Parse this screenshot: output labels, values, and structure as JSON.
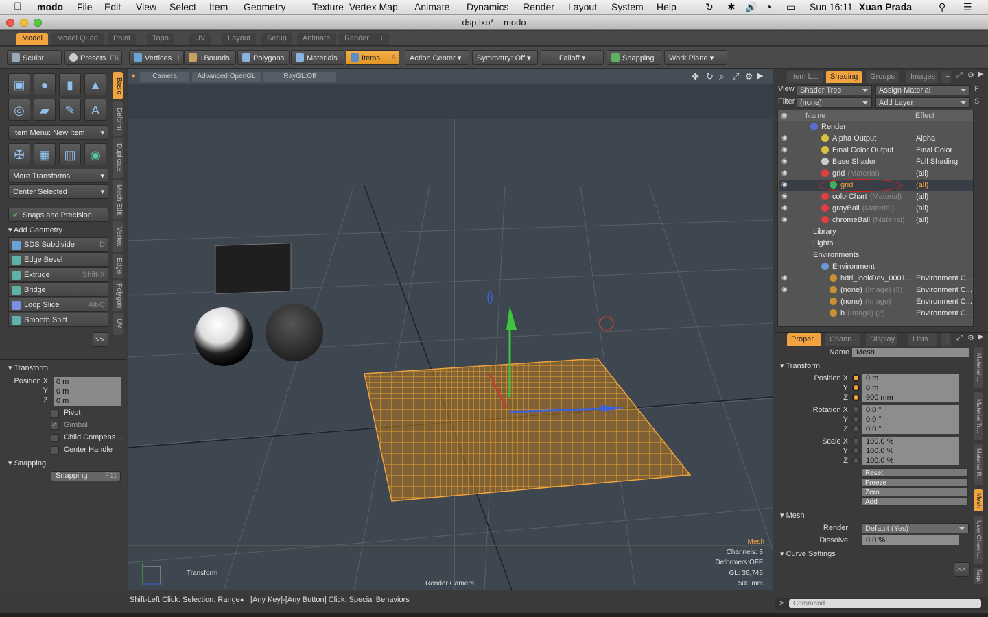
{
  "menubar": {
    "app": "modo",
    "items": [
      "File",
      "Edit",
      "View",
      "Select",
      "Item",
      "Geometry",
      "Texture",
      "Vertex Map",
      "Animate",
      "Dynamics",
      "Render",
      "Layout",
      "System",
      "Help"
    ],
    "clock": "Sun 16:11",
    "user": "Xuan Prada"
  },
  "window": {
    "title": "dsp.lxo* – modo"
  },
  "layout_tabs": [
    "Model",
    "Model Quad",
    "Paint",
    "Topo",
    "UV",
    "Layout",
    "Setup",
    "Animate",
    "Render",
    "+"
  ],
  "toolbar": {
    "sculpt": "Sculpt",
    "presets": "Presets",
    "presets_key": "F6",
    "vertices": "Vertices",
    "vertices_count": "1",
    "bounds": "+Bounds",
    "polygons": "Polygons",
    "materials": "Materials",
    "items": "Items",
    "items_count": "5",
    "action_center": "Action Center",
    "symmetry": "Symmetry: Off",
    "falloff": "Falloff",
    "snapping": "Snapping",
    "work_plane": "Work Plane"
  },
  "left": {
    "item_menu": "Item Menu: New Item",
    "more_transforms": "More Transforms",
    "center_selected": "Center Selected",
    "snaps_precision": "Snaps and Precision",
    "add_geometry": "Add Geometry",
    "tools": [
      {
        "label": "SDS Subdivide",
        "key": "D",
        "color": "#6aa3d8"
      },
      {
        "label": "Edge Bevel",
        "key": "",
        "color": "#5fb0a8"
      },
      {
        "label": "Extrude",
        "key": "Shift-X",
        "color": "#5fb0a8"
      },
      {
        "label": "Bridge",
        "key": "",
        "color": "#5fb0a8"
      },
      {
        "label": "Loop Slice",
        "key": "Alt-C",
        "color": "#7d8fe0"
      },
      {
        "label": "Smooth Shift",
        "key": "",
        "color": "#5fb0a8"
      }
    ],
    "more": ">>",
    "vtabs": [
      "Basic",
      "Deform",
      "Duplicate",
      "Mesh Edit",
      "Vertex",
      "Edge",
      "Polygon",
      "UV"
    ],
    "transform_hdr": "Transform",
    "position": [
      {
        "label": "Position X",
        "value": "0 m"
      },
      {
        "label": "Y",
        "value": "0 m"
      },
      {
        "label": "Z",
        "value": "0 m"
      }
    ],
    "checks": [
      {
        "label": "Pivot",
        "checked": false
      },
      {
        "label": "Gimbal",
        "checked": true
      },
      {
        "label": "Child Compens ...",
        "checked": false
      },
      {
        "label": "Center Handle",
        "checked": false
      }
    ],
    "snapping_hdr": "Snapping",
    "snapping_btn": "Snapping",
    "snapping_key": "F11"
  },
  "viewport": {
    "camera": "Camera",
    "shading": "Advanced OpenGL",
    "raygl": "RayGL:Off",
    "info_mesh": "Mesh",
    "info_channels": "Channels: 3",
    "info_deformers": "Deformers:OFF",
    "info_gl": "GL: 36,746",
    "info_scale": "500 mm",
    "tool_label": "Transform",
    "camera_label": "Render Camera"
  },
  "status": {
    "left": "Shift-Left Click: Selection: Range",
    "right": "[Any Key]-[Any Button] Click: Special Behaviors"
  },
  "shader": {
    "tabs": [
      "Item L...",
      "Shading",
      "Groups",
      "Images",
      "+"
    ],
    "view_label": "View",
    "view_value": "Shader Tree",
    "assign": "Assign Material",
    "assign_key": "F",
    "filter_label": "Filter",
    "filter_value": "(none)",
    "add_layer": "Add Layer",
    "add_layer_key": "S",
    "col_name": "Name",
    "col_effect": "Effect",
    "rows": [
      {
        "name": "Render",
        "suffix": "",
        "effect": "",
        "indent": 46,
        "eye": false,
        "dot": "#5a6ad0"
      },
      {
        "name": "Alpha Output",
        "suffix": "",
        "effect": "Alpha",
        "indent": 62,
        "eye": true,
        "dot": "#d8c040"
      },
      {
        "name": "Final Color Output",
        "suffix": "",
        "effect": "Final Color",
        "indent": 62,
        "eye": true,
        "dot": "#d8c040"
      },
      {
        "name": "Base Shader",
        "suffix": "",
        "effect": "Full Shading",
        "indent": 62,
        "eye": true,
        "dot": "#cccccc"
      },
      {
        "name": "grid",
        "suffix": "(Material)",
        "effect": "(all)",
        "indent": 62,
        "eye": true,
        "dot": "#e04040"
      },
      {
        "name": "grid",
        "suffix": "",
        "effect": "(all)",
        "indent": 74,
        "eye": true,
        "dot": "#40b060",
        "selected": true
      },
      {
        "name": "colorChart",
        "suffix": "(Material)",
        "effect": "(all)",
        "indent": 62,
        "eye": true,
        "dot": "#e04040"
      },
      {
        "name": "grayBall",
        "suffix": "(Material)",
        "effect": "(all)",
        "indent": 62,
        "eye": true,
        "dot": "#e04040"
      },
      {
        "name": "chromeBall",
        "suffix": "(Material)",
        "effect": "(all)",
        "indent": 62,
        "eye": true,
        "dot": "#e04040"
      },
      {
        "name": "Library",
        "suffix": "",
        "effect": "",
        "indent": 50,
        "eye": false,
        "dot": ""
      },
      {
        "name": "Lights",
        "suffix": "",
        "effect": "",
        "indent": 50,
        "eye": false,
        "dot": ""
      },
      {
        "name": "Environments",
        "suffix": "",
        "effect": "",
        "indent": 50,
        "eye": false,
        "dot": ""
      },
      {
        "name": "Environment",
        "suffix": "",
        "effect": "",
        "indent": 62,
        "eye": false,
        "dot": "#6a9ad8"
      },
      {
        "name": "hdri_lookDev_0001...",
        "suffix": "",
        "effect": "Environment C...",
        "indent": 74,
        "eye": true,
        "dot": "#c89030"
      },
      {
        "name": "(none)",
        "suffix": "(Image) (3)",
        "effect": "Environment C...",
        "indent": 74,
        "eye": true,
        "dot": "#c89030"
      },
      {
        "name": "(none)",
        "suffix": "(Image)",
        "effect": "Environment C...",
        "indent": 74,
        "eye": false,
        "dot": "#c89030"
      },
      {
        "name": "b",
        "suffix": "(Image) (2)",
        "effect": "Environment C...",
        "indent": 74,
        "eye": false,
        "dot": "#c89030"
      }
    ]
  },
  "props": {
    "tabs": [
      "Proper...",
      "Chann...",
      "Display",
      "Lists",
      "+"
    ],
    "name_label": "Name",
    "name_value": "Mesh",
    "transform_hdr": "Transform",
    "position": [
      {
        "label": "Position X",
        "value": "0 m"
      },
      {
        "label": "Y",
        "value": "0 m"
      },
      {
        "label": "Z",
        "value": "900 mm"
      }
    ],
    "rotation": [
      {
        "label": "Rotation X",
        "value": "0.0 °"
      },
      {
        "label": "Y",
        "value": "0.0 °"
      },
      {
        "label": "Z",
        "value": "0.0 °"
      }
    ],
    "scale": [
      {
        "label": "Scale X",
        "value": "100.0 %"
      },
      {
        "label": "Y",
        "value": "100.0 %"
      },
      {
        "label": "Z",
        "value": "100.0 %"
      }
    ],
    "buttons": [
      "Reset",
      "Freeze",
      "Zero",
      "Add"
    ],
    "mesh_hdr": "Mesh",
    "render_label": "Render",
    "render_value": "Default (Yes)",
    "dissolve_label": "Dissolve",
    "dissolve_value": "0.0 %",
    "curve_hdr": "Curve Settings",
    "more": ">>",
    "vtabs": [
      "Material ...",
      "Material Tr...",
      "Material R...",
      "Mesh",
      "User Chann...",
      "Tags"
    ]
  },
  "command": {
    "placeholder": "Command",
    "prompt": ">"
  }
}
